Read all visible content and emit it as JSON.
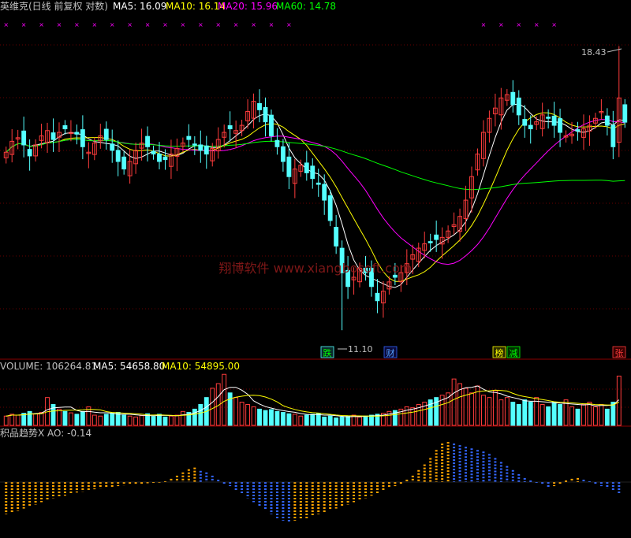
{
  "colors": {
    "background": "#000000",
    "up": "#ff3c3c",
    "down": "#54ffff",
    "ma5": "#ffffff",
    "ma10": "#ffff00",
    "ma20": "#ff00ff",
    "ma60": "#00ff00",
    "grid": "#8b0000",
    "ao_pos": "#ffa500",
    "ao_neg": "#3366ff",
    "label": "#c0c0c0"
  },
  "price_panel": {
    "title": "英维克(日线 前复权 对数)",
    "ma5_label": "MA5: 16.09",
    "ma10_label": "MA10: 16.14",
    "ma20_label": "MA20: 15.96",
    "ma60_label": "MA60: 14.78",
    "high_label": "18.43",
    "low_label": "11.10",
    "watermark": "翔博软件 www.xiangbosoft.com",
    "signal_die": "跌",
    "signal_cai": "财",
    "signal_bang": "榜",
    "signal_jian": "减",
    "signal_zhang": "张"
  },
  "volume_panel": {
    "title": "VOLUME: 106264.81",
    "ma5_label": "MA5: 54658.80",
    "ma10_label": "MA10: 54895.00"
  },
  "ao_panel": {
    "title": "积品趋势X AO: -0.14"
  },
  "chart_data": [
    {
      "type": "candlestick",
      "panel": "price",
      "title": "英维克(日线 前复权 对数)",
      "ylim": [
        10.6,
        19.4
      ],
      "log_scale": true,
      "high": 18.43,
      "low": 11.1,
      "legend": [
        "MA5",
        "MA10",
        "MA20",
        "MA60"
      ],
      "close": [
        15.25,
        15.55,
        15.65,
        15.45,
        15.15,
        15.45,
        15.7,
        15.85,
        15.6,
        15.8,
        15.9,
        15.8,
        15.75,
        15.4,
        15.25,
        15.5,
        15.7,
        15.6,
        15.3,
        15.0,
        14.8,
        15.0,
        15.3,
        15.5,
        15.4,
        15.2,
        15.0,
        15.05,
        15.2,
        15.35,
        15.5,
        15.6,
        15.45,
        15.3,
        15.2,
        15.35,
        15.6,
        15.8,
        15.9,
        15.85,
        16.0,
        16.4,
        16.7,
        16.45,
        16.1,
        15.7,
        15.4,
        15.0,
        14.6,
        14.8,
        14.9,
        14.7,
        14.55,
        14.4,
        14.0,
        13.5,
        12.9,
        12.3,
        12.0,
        12.2,
        12.4,
        12.3,
        12.0,
        11.7,
        11.9,
        12.1,
        12.2,
        12.3,
        12.5,
        12.7,
        12.85,
        12.95,
        13.0,
        13.05,
        13.1,
        13.25,
        13.4,
        13.6,
        14.0,
        14.6,
        15.2,
        15.8,
        16.2,
        16.5,
        16.8,
        16.9,
        16.6,
        16.3,
        16.0,
        15.9,
        16.1,
        16.3,
        16.2,
        16.0,
        15.8,
        15.7,
        15.75,
        15.85,
        15.9,
        16.0,
        16.2,
        16.4,
        16.0,
        15.4,
        16.8,
        16.09
      ]
    },
    {
      "type": "bar",
      "panel": "volume",
      "title": "VOLUME",
      "legend": [
        "MA5",
        "MA10"
      ],
      "values": [
        20000,
        24000,
        22000,
        26000,
        30000,
        25000,
        28000,
        60000,
        45000,
        35000,
        30000,
        27000,
        24000,
        30000,
        40000,
        22000,
        20000,
        24000,
        26000,
        28000,
        22000,
        20000,
        18000,
        21000,
        25000,
        19000,
        24000,
        18000,
        20000,
        22000,
        30000,
        28000,
        35000,
        45000,
        60000,
        80000,
        90000,
        110000,
        70000,
        60000,
        50000,
        45000,
        40000,
        35000,
        32000,
        34000,
        30000,
        28000,
        25000,
        24000,
        20000,
        22000,
        24000,
        26000,
        18000,
        20000,
        16000,
        18000,
        20000,
        22000,
        18000,
        20000,
        22000,
        24000,
        26000,
        30000,
        32000,
        35000,
        40000,
        38000,
        45000,
        50000,
        55000,
        60000,
        65000,
        70000,
        100000,
        90000,
        80000,
        70000,
        85000,
        65000,
        60000,
        75000,
        55000,
        60000,
        50000,
        45000,
        55000,
        50000,
        60000,
        45000,
        40000,
        50000,
        45000,
        55000,
        40000,
        35000,
        45000,
        50000,
        40000,
        45000,
        35000,
        50000,
        106264.81
      ],
      "ma5": 54658.8,
      "ma10": 54895.0
    },
    {
      "type": "bar",
      "panel": "ao",
      "title": "积品趋势X AO",
      "last_value": -0.14,
      "values": [
        -0.4,
        -0.38,
        -0.36,
        -0.33,
        -0.3,
        -0.28,
        -0.25,
        -0.22,
        -0.2,
        -0.18,
        -0.17,
        -0.15,
        -0.13,
        -0.12,
        -0.1,
        -0.09,
        -0.08,
        -0.07,
        -0.06,
        -0.05,
        -0.04,
        -0.03,
        -0.025,
        -0.02,
        -0.015,
        -0.01,
        -0.008,
        0.01,
        0.04,
        0.08,
        0.12,
        0.16,
        0.18,
        0.14,
        0.12,
        0.08,
        0.03,
        -0.02,
        -0.05,
        -0.1,
        -0.15,
        -0.2,
        -0.25,
        -0.3,
        -0.35,
        -0.4,
        -0.45,
        -0.48,
        -0.5,
        -0.48,
        -0.46,
        -0.45,
        -0.43,
        -0.4,
        -0.38,
        -0.35,
        -0.33,
        -0.3,
        -0.28,
        -0.25,
        -0.22,
        -0.2,
        -0.17,
        -0.14,
        -0.1,
        -0.07,
        -0.05,
        -0.02,
        0.03,
        0.08,
        0.15,
        0.22,
        0.3,
        0.4,
        0.48,
        0.5,
        0.48,
        0.46,
        0.44,
        0.42,
        0.4,
        0.38,
        0.35,
        0.3,
        0.25,
        0.2,
        0.15,
        0.1,
        0.05,
        0.02,
        -0.01,
        -0.03,
        -0.06,
        -0.05,
        -0.02,
        0.02,
        0.04,
        0.05,
        0.03,
        0.01,
        -0.02,
        -0.05,
        -0.08,
        -0.1,
        -0.14
      ]
    }
  ]
}
